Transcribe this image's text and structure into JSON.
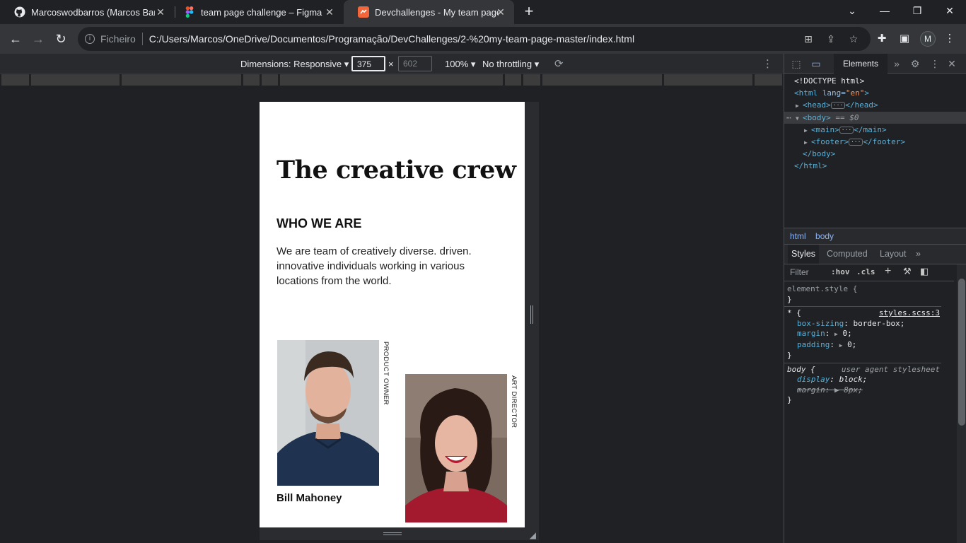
{
  "browser": {
    "tabs": [
      {
        "title": "Marcoswodbarros (Marcos Barros)",
        "favicon": "github-icon"
      },
      {
        "title": "team page challenge – Figma",
        "favicon": "figma-icon"
      },
      {
        "title": "Devchallenges - My team page",
        "favicon": "devchallenges-icon"
      }
    ],
    "new_tab": "+",
    "address": {
      "scheme_label": "Ficheiro",
      "url": "C:/Users/Marcos/OneDrive/Documentos/Programação/DevChallenges/2-%20my-team-page-master/index.html"
    },
    "profile_initial": "M"
  },
  "device_toolbar": {
    "dimensions_label": "Dimensions: Responsive",
    "width": "375",
    "height": "602",
    "times": "×",
    "zoom": "100%",
    "throttling": "No throttling"
  },
  "page": {
    "title": "The creative crew",
    "subtitle": "WHO WE ARE",
    "description": "We are team of creatively diverse. driven. innovative individuals working in various locations from the world.",
    "members": [
      {
        "name": "Bill Mahoney",
        "role": "PRODUCT OWNER"
      },
      {
        "name": "",
        "role": "ART DIRECTOR"
      }
    ]
  },
  "devtools": {
    "main_tab": "Elements",
    "dom": {
      "doctype": "<!DOCTYPE html>",
      "html_open": "<html lang=\"en\">",
      "html_tag": "html",
      "lang_attr": "lang",
      "lang_val": "\"en\"",
      "head_open": "<head>",
      "head_close": "</head>",
      "body_open": "<body>",
      "body_marker": "== $0",
      "main_open": "<main>",
      "main_close": "</main>",
      "footer_open": "<footer>",
      "footer_close": "</footer>",
      "body_close": "</body>",
      "html_close": "</html>"
    },
    "breadcrumbs": [
      "html",
      "body"
    ],
    "styles_tabs": [
      "Styles",
      "Computed",
      "Layout"
    ],
    "filter_placeholder": "Filter",
    "hov": ":hov",
    "cls": ".cls",
    "rules": {
      "element_style": "element.style {",
      "close_brace": "}",
      "universal_selector": "* {",
      "universal_source": "styles.scss:3",
      "box_sizing_prop": "box-sizing",
      "box_sizing_val": "border-box;",
      "margin_prop": "margin",
      "margin_val": "0;",
      "padding_prop": "padding",
      "padding_val": "0;",
      "body_selector": "body {",
      "body_source": "user agent stylesheet",
      "display_prop": "display",
      "display_val": "block;",
      "body_margin_prop": "margin",
      "body_margin_val": "8px;"
    }
  },
  "colors": {
    "chrome_bg": "#202124",
    "toolbar_bg": "#35363a",
    "devtools_accent": "#8ab4f8",
    "tag_color": "#5db0d7"
  }
}
